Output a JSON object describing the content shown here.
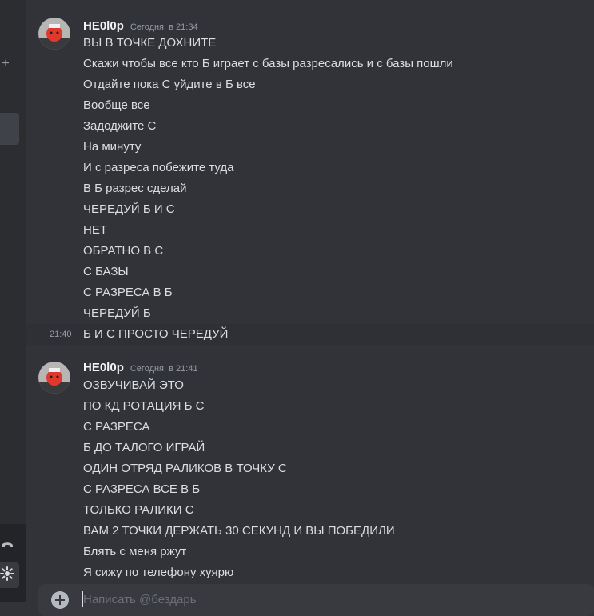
{
  "sidebar": {
    "add_icon": "plus-icon",
    "call_icon": "phone-icon",
    "settings_icon": "gear-icon"
  },
  "groups": [
    {
      "username": "HE0l0p",
      "timestamp": "Сегодня, в 21:34",
      "messages": [
        "ВЫ В ТОЧКЕ ДОХНИТЕ",
        "Скажи чтобы все кто Б играет с базы разресались и с базы пошли",
        "Отдайте пока С уйдите в Б все",
        "Вообще все",
        "Задоджите С",
        "На минуту",
        "И с разреса побежите туда",
        "В Б разрес сделай",
        "ЧЕРЕДУЙ Б И С",
        "НЕТ",
        "ОБРАТНО В С",
        "С БАЗЫ",
        "С РАЗРЕСА В Б",
        "ЧЕРЕДУЙ Б"
      ],
      "hover_message": {
        "time": "21:40",
        "text": "Б И С ПРОСТО ЧЕРЕДУЙ"
      }
    },
    {
      "username": "HE0l0p",
      "timestamp": "Сегодня, в 21:41",
      "messages": [
        "ОЗВУЧИВАЙ ЭТО",
        "ПО КД РОТАЦИЯ Б С",
        "С РАЗРЕСА",
        "Б ДО ТАЛОГО ИГРАЙ",
        "ОДИН ОТРЯД РАЛИКОВ В ТОЧКУ С",
        "С РАЗРЕСА ВСЕ В Б",
        "ТОЛЬКО РАЛИКИ С",
        "ВАМ 2 ТОЧКИ ДЕРЖАТЬ 30 СЕКУНД И ВЫ ПОБЕДИЛИ",
        "Блять с меня ржут",
        "Я сижу по телефону хуярю"
      ]
    }
  ],
  "composer": {
    "placeholder": "Написать @бездарь"
  }
}
